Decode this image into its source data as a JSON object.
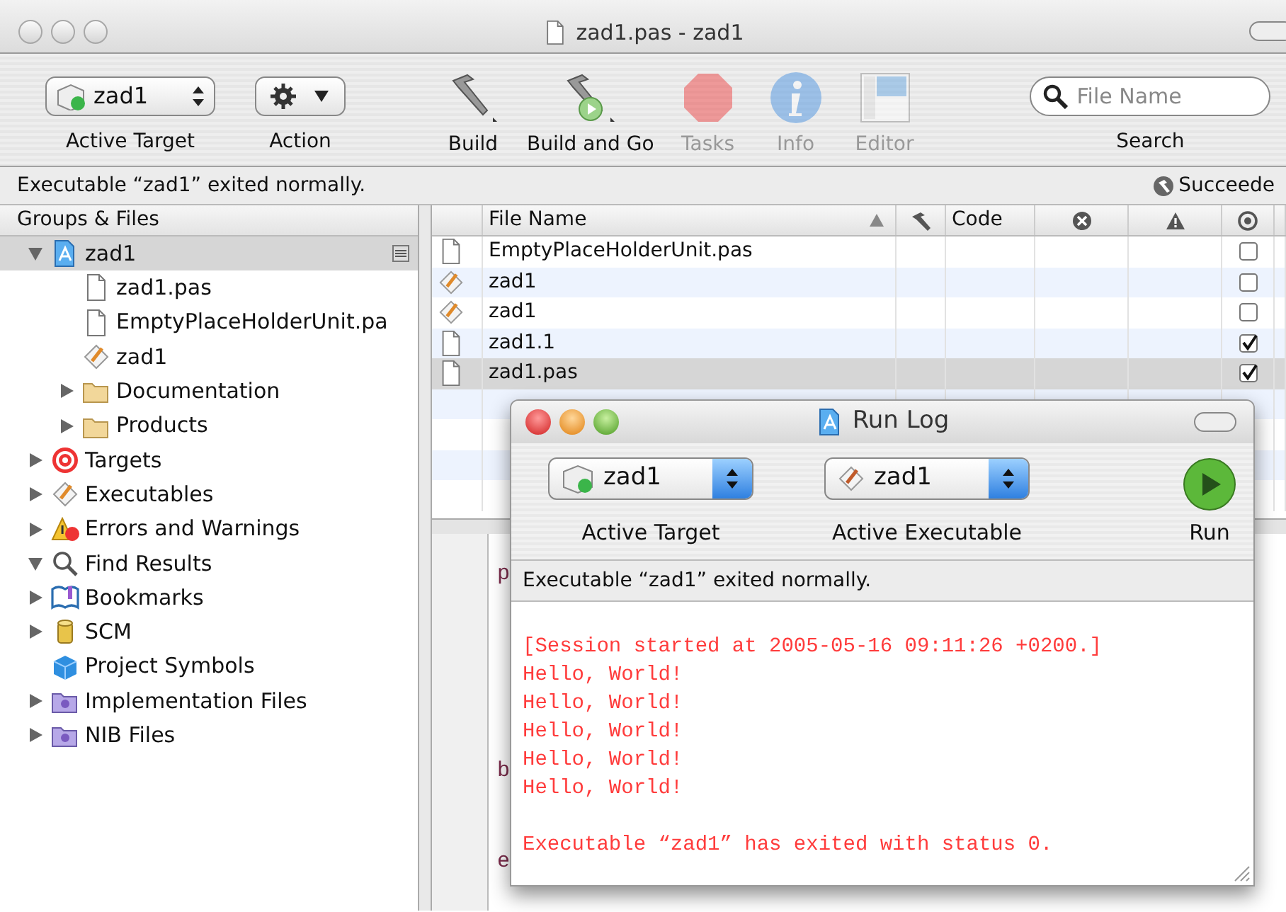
{
  "window": {
    "title": "zad1.pas - zad1"
  },
  "toolbar": [
    {
      "kind": "target",
      "value": "zad1",
      "label": "Active Target"
    },
    {
      "kind": "action",
      "label": "Action"
    },
    {
      "kind": "build",
      "label": "Build",
      "disabled": false
    },
    {
      "kind": "buildgo",
      "label": "Build and Go",
      "disabled": false
    },
    {
      "kind": "tasks",
      "label": "Tasks",
      "disabled": true
    },
    {
      "kind": "info",
      "label": "Info",
      "disabled": true
    },
    {
      "kind": "editor",
      "label": "Editor",
      "disabled": true
    },
    {
      "kind": "search",
      "placeholder": "File Name",
      "label": "Search"
    }
  ],
  "status_bar": {
    "message": "Executable “zad1” exited normally.",
    "result": "Succeede"
  },
  "sidebar": {
    "header": "Groups & Files",
    "items": [
      {
        "label": "zad1",
        "kind": "project",
        "expanded": true,
        "selected": true,
        "children": [
          {
            "label": "zad1.pas",
            "kind": "file",
            "selected": false
          },
          {
            "label": "EmptyPlaceHolderUnit.pa",
            "kind": "file",
            "selected": false
          },
          {
            "label": "zad1",
            "kind": "exec",
            "selected": false
          },
          {
            "label": "Documentation",
            "kind": "folder",
            "expanded": false,
            "selected": false
          },
          {
            "label": "Products",
            "kind": "folder",
            "expanded": false,
            "selected": false
          }
        ]
      },
      {
        "label": "Targets",
        "kind": "target",
        "expanded": false,
        "selected": false
      },
      {
        "label": "Executables",
        "kind": "exec",
        "expanded": false,
        "selected": false
      },
      {
        "label": "Errors and Warnings",
        "kind": "warning",
        "expanded": false,
        "selected": false
      },
      {
        "label": "Find Results",
        "kind": "search",
        "expanded": true,
        "selected": false
      },
      {
        "label": "Bookmarks",
        "kind": "bookmark",
        "expanded": false,
        "selected": false
      },
      {
        "label": "SCM",
        "kind": "scm",
        "expanded": false,
        "selected": false
      },
      {
        "label": "Project Symbols",
        "kind": "symbols",
        "selected": false
      },
      {
        "label": "Implementation Files",
        "kind": "impl",
        "expanded": false,
        "selected": false
      },
      {
        "label": "NIB Files",
        "kind": "impl",
        "expanded": false,
        "selected": false
      }
    ]
  },
  "table": {
    "columns": [
      {
        "kind": "blank"
      },
      {
        "kind": "text",
        "label": "File Name"
      },
      {
        "kind": "build"
      },
      {
        "kind": "text",
        "label": "Code"
      },
      {
        "kind": "errors"
      },
      {
        "kind": "warnings"
      },
      {
        "kind": "target"
      }
    ],
    "rows": [
      {
        "name": "EmptyPlaceHolderUnit.pas",
        "kind": "file",
        "checked": false,
        "selected": false
      },
      {
        "name": "zad1",
        "kind": "exec",
        "checked": false,
        "selected": false
      },
      {
        "name": "zad1",
        "kind": "exec",
        "checked": false,
        "selected": false
      },
      {
        "name": "zad1.1",
        "kind": "file",
        "checked": true,
        "selected": false
      },
      {
        "name": "zad1.pas",
        "kind": "file",
        "checked": true,
        "selected": true
      }
    ]
  },
  "editor_lines": [
    "p",
    "b",
    "e"
  ],
  "run_log": {
    "title": "Run Log",
    "popups": [
      {
        "kind": "target",
        "value": "zad1",
        "label": "Active Target"
      },
      {
        "kind": "exec",
        "value": "zad1",
        "label": "Active Executable"
      }
    ],
    "run_label": "Run",
    "status": "Executable “zad1” exited normally.",
    "lines": [
      "[Session started at 2005-05-16 09:11:26 +0200.]",
      "Hello, World!",
      "Hello, World!",
      "Hello, World!",
      "Hello, World!",
      "Hello, World!"
    ],
    "footer": "Executable “zad1” has exited with status 0."
  }
}
